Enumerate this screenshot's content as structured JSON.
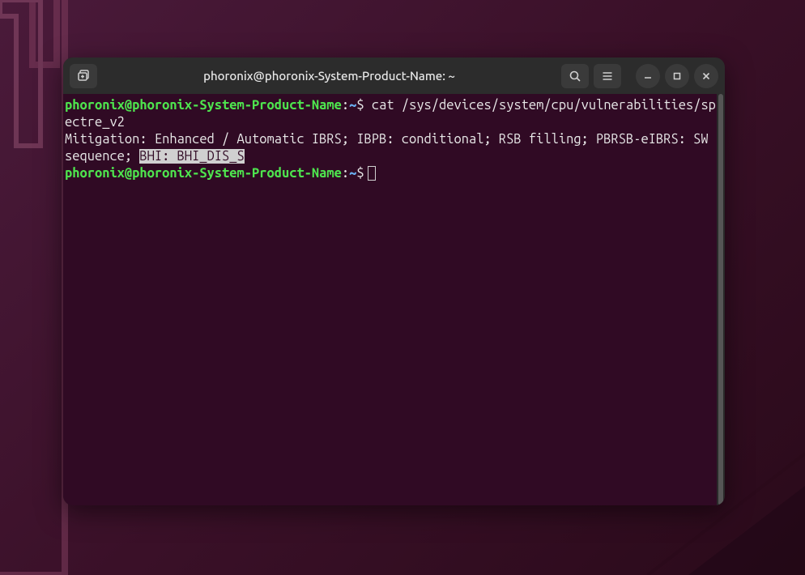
{
  "titlebar": {
    "title": "phoronix@phoronix-System-Product-Name: ~"
  },
  "prompt": {
    "user_host": "phoronix@phoronix-System-Product-Name",
    "colon": ":",
    "path": "~",
    "dollar": "$"
  },
  "lines": {
    "cmd1": " cat /sys/devices/system/cpu/vulnerabilities/spectre_v2",
    "out1_pre": "Mitigation: Enhanced / Automatic IBRS; IBPB: conditional; RSB filling; PBRSB-eIBRS: SW sequence; ",
    "out1_hl": "BHI: BHI_DIS_S"
  },
  "icons": {
    "new_tab": "new-tab-icon",
    "search": "search-icon",
    "menu": "hamburger-menu-icon",
    "minimize": "minimize-icon",
    "maximize": "maximize-icon",
    "close": "close-icon"
  }
}
